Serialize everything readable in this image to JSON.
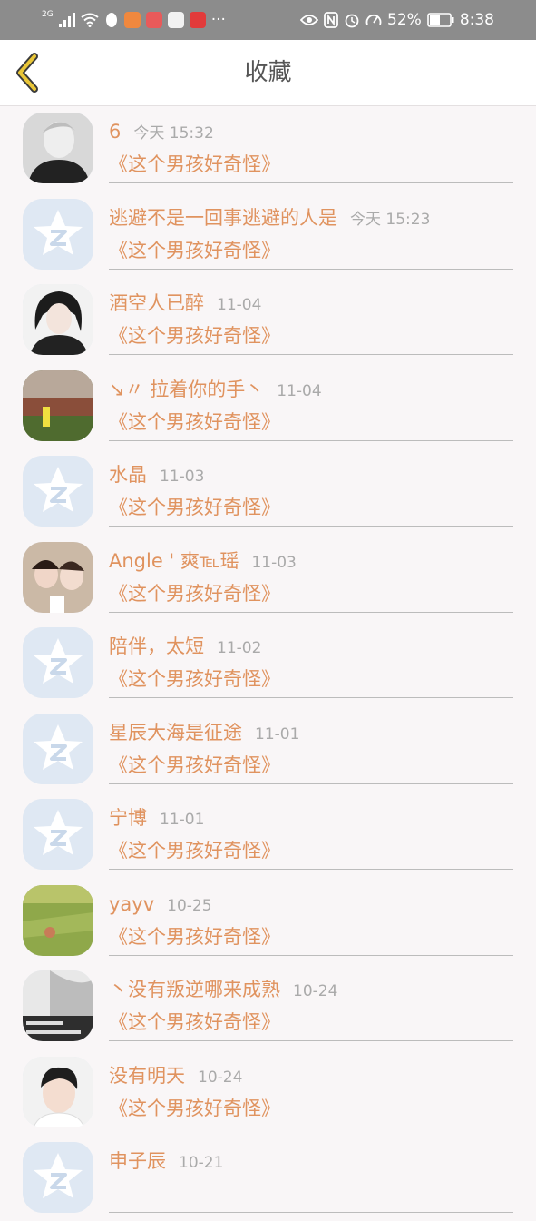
{
  "status_bar": {
    "network": "2G",
    "battery": "52%",
    "time": "8:38",
    "more": "···"
  },
  "header": {
    "title": "收藏",
    "back_icon": "chevron-left-icon",
    "accent_color": "#e9c638"
  },
  "items": [
    {
      "name": "6",
      "time": "今天 15:32",
      "song": "《这个男孩好奇怪》",
      "avatar": "photo-bw-portrait"
    },
    {
      "name": "逃避不是一回事逃避的人是",
      "time": "今天 15:23",
      "song": "《这个男孩好奇怪》",
      "avatar": "default-qzone-star"
    },
    {
      "name": "酒空人已醉",
      "time": "11-04",
      "song": "《这个男孩好奇怪》",
      "avatar": "photo-girl-portrait"
    },
    {
      "name": "↘〃 拉着你的手丶",
      "time": "11-04",
      "song": "《这个男孩好奇怪》",
      "avatar": "photo-outdoor"
    },
    {
      "name": "水晶",
      "time": "11-03",
      "song": "《这个男孩好奇怪》",
      "avatar": "default-qzone-star"
    },
    {
      "name": "Angle ' 爽℡瑶",
      "time": "11-03",
      "song": "《这个男孩好奇怪》",
      "avatar": "photo-two-girls"
    },
    {
      "name": "陪伴，太短",
      "time": "11-02",
      "song": "《这个男孩好奇怪》",
      "avatar": "default-qzone-star"
    },
    {
      "name": "星辰大海是征途",
      "time": "11-01",
      "song": "《这个男孩好奇怪》",
      "avatar": "default-qzone-star"
    },
    {
      "name": "宁博",
      "time": "11-01",
      "song": "《这个男孩好奇怪》",
      "avatar": "default-qzone-star"
    },
    {
      "name": "yayv",
      "time": "10-25",
      "song": "《这个男孩好奇怪》",
      "avatar": "photo-grass-field"
    },
    {
      "name": "丶没有叛逆哪来成熟",
      "time": "10-24",
      "song": "《这个男孩好奇怪》",
      "avatar": "photo-text-image"
    },
    {
      "name": "没有明天",
      "time": "10-24",
      "song": "《这个男孩好奇怪》",
      "avatar": "photo-boy-portrait"
    },
    {
      "name": "申子辰",
      "time": "10-21",
      "song": "",
      "avatar": "default-qzone-star"
    }
  ]
}
